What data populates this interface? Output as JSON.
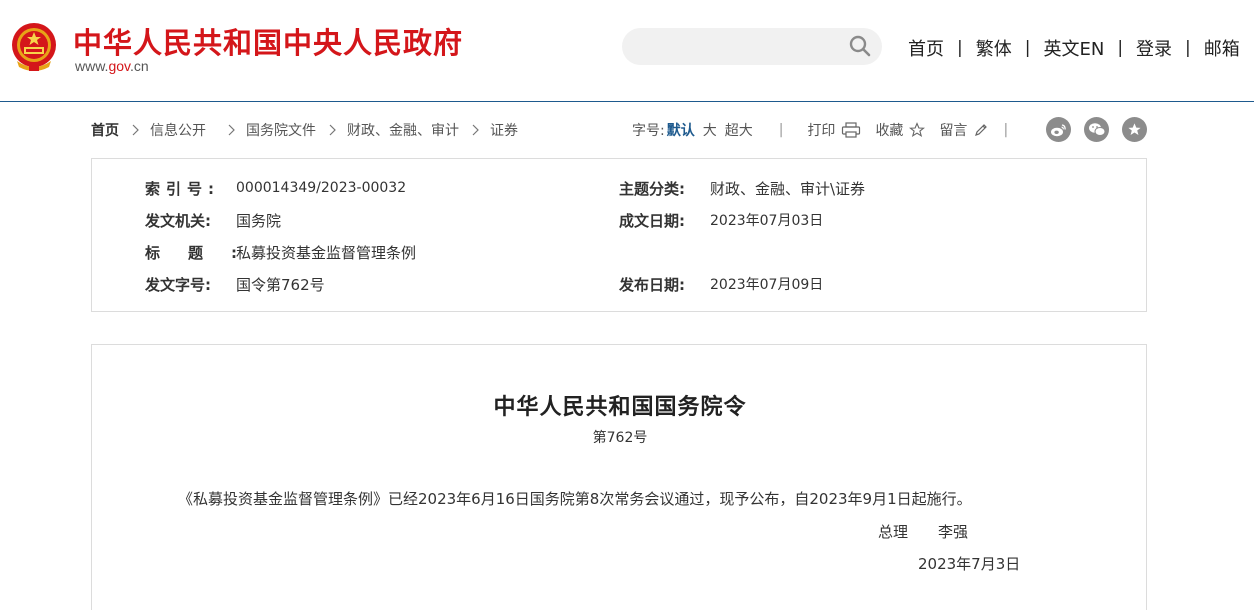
{
  "header": {
    "site_title": "中华人民共和国中央人民政府",
    "site_url_pre": "www.",
    "site_url_mid": "gov",
    "site_url_post": ".cn",
    "search_placeholder": "",
    "nav": [
      "首页",
      "繁体",
      "英文EN",
      "登录",
      "邮箱"
    ],
    "nav_sep": "|"
  },
  "breadcrumb": {
    "items": [
      "首页",
      "信息公开",
      "国务院文件",
      "财政、金融、审计",
      "证券"
    ]
  },
  "tools": {
    "font_label": "字号:",
    "font_default": "默认",
    "font_large": "大",
    "font_xlarge": "超大",
    "sep": "|",
    "print": "打印",
    "favorite": "收藏",
    "comment": "留言",
    "sep2": "|"
  },
  "info": {
    "index_no_label": "索引号:",
    "index_no": "000014349/2023-00032",
    "topic_label": "主题分类:",
    "topic": "财政、金融、审计\\证券",
    "issuer_label": "发文机关:",
    "issuer": "国务院",
    "created_label": "成文日期:",
    "created": "2023年07月03日",
    "title_label": "标题:",
    "title": "私募投资基金监督管理条例",
    "doc_no_label": "发文字号:",
    "doc_no": "国令第762号",
    "published_label": "发布日期:",
    "published": "2023年07月09日"
  },
  "document": {
    "title": "中华人民共和国国务院令",
    "number": "第762号",
    "paragraph": "《私募投资基金监督管理条例》已经2023年6月16日国务院第8次常务会议通过，现予公布，自2023年9月1日起施行。",
    "sign_role": "总理",
    "sign_name": "李强",
    "date": "2023年7月3日"
  },
  "colors": {
    "brand_red": "#d4161a",
    "accent_blue": "#1e5a8e",
    "icon_gray": "#8c8c8c"
  }
}
